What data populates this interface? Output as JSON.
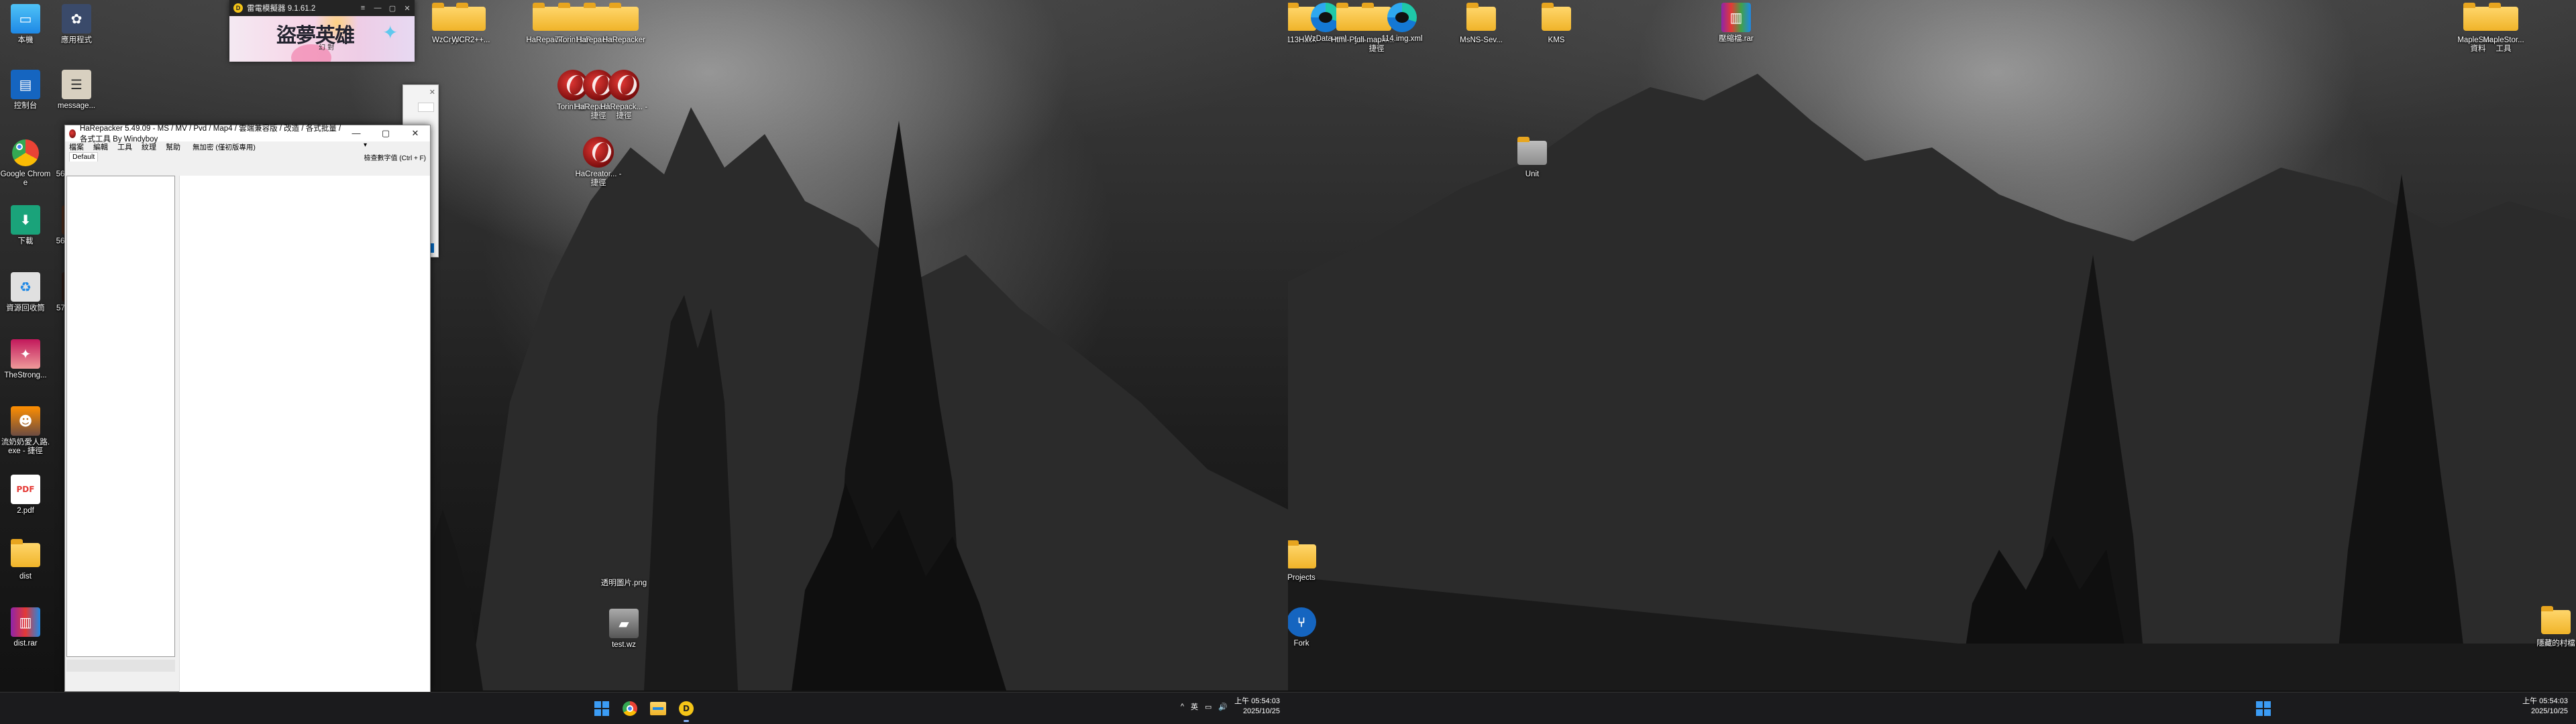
{
  "left_desktop_icons": [
    {
      "label": "本機",
      "color": "#1e88e5"
    },
    {
      "label": "應用程式",
      "color": "#3a4a6a"
    },
    {
      "label": "控制台",
      "color": "#1565c0"
    },
    {
      "label": "message...",
      "color": "#777777"
    },
    {
      "label": "Google Chrome",
      "color": "#ffffff"
    },
    {
      "label": "56827497...",
      "color": "#333333"
    },
    {
      "label": "下載",
      "color": "#1aa37a"
    },
    {
      "label": "56962821...",
      "color": "#4a2a1a"
    },
    {
      "label": "資源回收筒",
      "color": "#e0e0e0"
    },
    {
      "label": "57151411...",
      "color": "#2a1a14"
    },
    {
      "label": "TheStrong...",
      "color": "#c2185b"
    },
    {
      "label": "流奶奶愛人路.exe - 捷徑",
      "color": "#ff8f00"
    },
    {
      "label": "2.pdf",
      "color": "#e53935"
    },
    {
      "label": "dist",
      "color": "#f0b429"
    },
    {
      "label": "dist.rar",
      "color": "#8e24aa"
    }
  ],
  "top_desktop_icons": [
    {
      "label": "WzCrypt"
    },
    {
      "label": "WCR2++..."
    },
    {
      "label": "HaRepack..."
    },
    {
      "label": "7TorinHaR"
    },
    {
      "label": "Harepacke..."
    },
    {
      "label": "HaRepacker"
    }
  ],
  "harepack_icons": [
    {
      "label": "TorinHaR"
    },
    {
      "label": "HaRepack... - 捷徑"
    },
    {
      "label": "HaRepack... - 捷徑"
    },
    {
      "label": "HaCreator... - 捷徑"
    }
  ],
  "left_bottom_icons": [
    {
      "label": "透明圖片.png"
    },
    {
      "label": "test.wz"
    }
  ],
  "ld_window": {
    "title": "雷電模擬器 9.1.61.2",
    "logo_letter": "D",
    "banner_title": "盜夢英雄",
    "banner_sub": "幻 對",
    "controls": [
      "≡",
      "—",
      "▢",
      "✕"
    ]
  },
  "harepacker": {
    "title": "HaRepacker 5.49.09 - MS / MV / Pvd / Map4 / 雲端兼容版 / 改造 / 各式批量 / 各式工具 By Windyboy",
    "menu": [
      "檔案",
      "編輯",
      "工具",
      "紋理",
      "幫助"
    ],
    "encoding": "無加密 (僅初版專用)",
    "tab": "Default",
    "search_hint": "檢查數字值 (Ctrl + F)",
    "controls": [
      "—",
      "▢",
      "✕"
    ]
  },
  "left_taskbar": {
    "apps": [
      "start",
      "chrome",
      "explorer",
      "ldplayer"
    ],
    "tray_icons": [
      "^",
      "英",
      "▭",
      "🔊"
    ],
    "time": "上午 05:54:03",
    "date": "2025/10/25"
  },
  "right_top_icons": [
    {
      "label": "113Hack",
      "type": "folder"
    },
    {
      "label": "WzData.xml",
      "type": "edge"
    },
    {
      "label": "Html-Pyth...",
      "type": "folder"
    },
    {
      "label": "full-maple... - 捷徑",
      "type": "folder"
    },
    {
      "label": "114.img.xml",
      "type": "edge"
    },
    {
      "label": "MsNS-Sev...",
      "type": "folder"
    },
    {
      "label": "KMS",
      "type": "folder"
    },
    {
      "label": "壓縮檔.rar",
      "type": "rar"
    },
    {
      "label": "MapleStor... 資料",
      "type": "folder"
    },
    {
      "label": "MapleStor... 工具",
      "type": "folder"
    }
  ],
  "right_mid_icons": [
    {
      "label": "Unit"
    },
    {
      "label": "Projects"
    },
    {
      "label": "Fork"
    },
    {
      "label": "隱藏的村檔"
    }
  ],
  "right_taskbar": {
    "time": "上午 05:54:03",
    "date": "2025/10/25"
  }
}
